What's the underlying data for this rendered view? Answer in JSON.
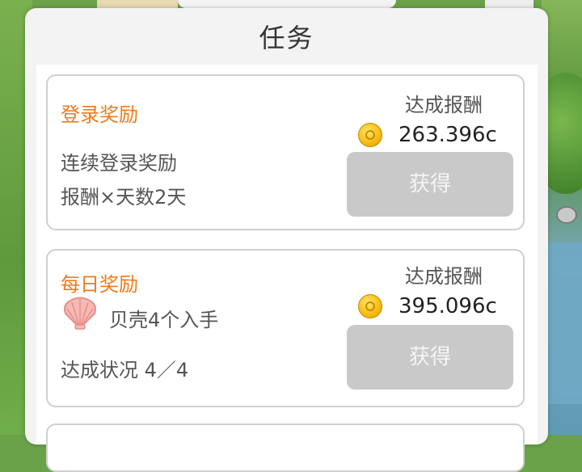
{
  "dialog": {
    "title": "任务"
  },
  "tasks": [
    {
      "title": "登录奖励",
      "lines": [
        "连续登录奖励",
        "报酬×天数2天"
      ],
      "reward_label": "达成报酬",
      "reward_amount": "263.396c",
      "button_label": "获得"
    },
    {
      "title": "每日奖励",
      "item_text": "贝壳4个入手",
      "status_text": "达成状况  4／4",
      "reward_label": "达成报酬",
      "reward_amount": "395.096c",
      "button_label": "获得"
    }
  ],
  "colors": {
    "title_orange": "#f07a1a",
    "button_disabled": "#c9c9c9",
    "coin_gold": "#f2b400"
  },
  "icons": {
    "coin": "coin-icon",
    "shell": "shell-icon"
  }
}
